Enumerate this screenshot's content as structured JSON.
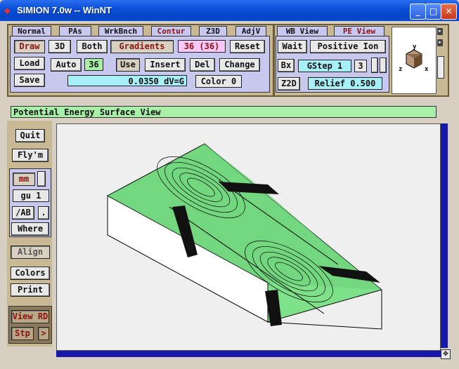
{
  "window": {
    "title": "SIMION 7.0w -- WinNT"
  },
  "tabs_left": [
    {
      "label": "Normal"
    },
    {
      "label": "PAs"
    },
    {
      "label": "WrkBnch"
    },
    {
      "label": "Contur"
    },
    {
      "label": "Z3D"
    },
    {
      "label": "AdjV"
    }
  ],
  "tabs_right": [
    {
      "label": "WB View"
    },
    {
      "label": "PE View"
    }
  ],
  "contour": {
    "draw": "Draw",
    "view3d": "3D",
    "both": "Both",
    "gradients": "Gradients",
    "count": "36 (36)",
    "reset": "Reset",
    "load": "Load",
    "auto": "Auto",
    "auto_value": "36",
    "use": "Use",
    "insert": "Insert",
    "del": "Del",
    "change": "Change",
    "save": "Save",
    "dv_value": "0.0350 dV=G",
    "color": "Color 0"
  },
  "peview": {
    "wait": "Wait",
    "ion": "Positive Ion",
    "bx": "Bx",
    "gstep": "GStep 1",
    "gstep_num": "3",
    "z2d": "Z2D",
    "relief": "Relief 0.500"
  },
  "axes": {
    "y": "y",
    "z": "z",
    "x": "x"
  },
  "status": "Potential Energy Surface View",
  "left_panel": {
    "quit": "Quit",
    "flym": "Fly'm",
    "mm": "mm",
    "gu": "gu 1",
    "ab": "/AB",
    "dot": ".",
    "where": "Where",
    "align": "Align",
    "colors": "Colors",
    "print": "Print",
    "viewrd": "View RD",
    "stp": "Stp"
  },
  "colors": {
    "surface_green": "#7fe08a",
    "panel": "#c8b894",
    "accent_red": "#8b1010"
  }
}
